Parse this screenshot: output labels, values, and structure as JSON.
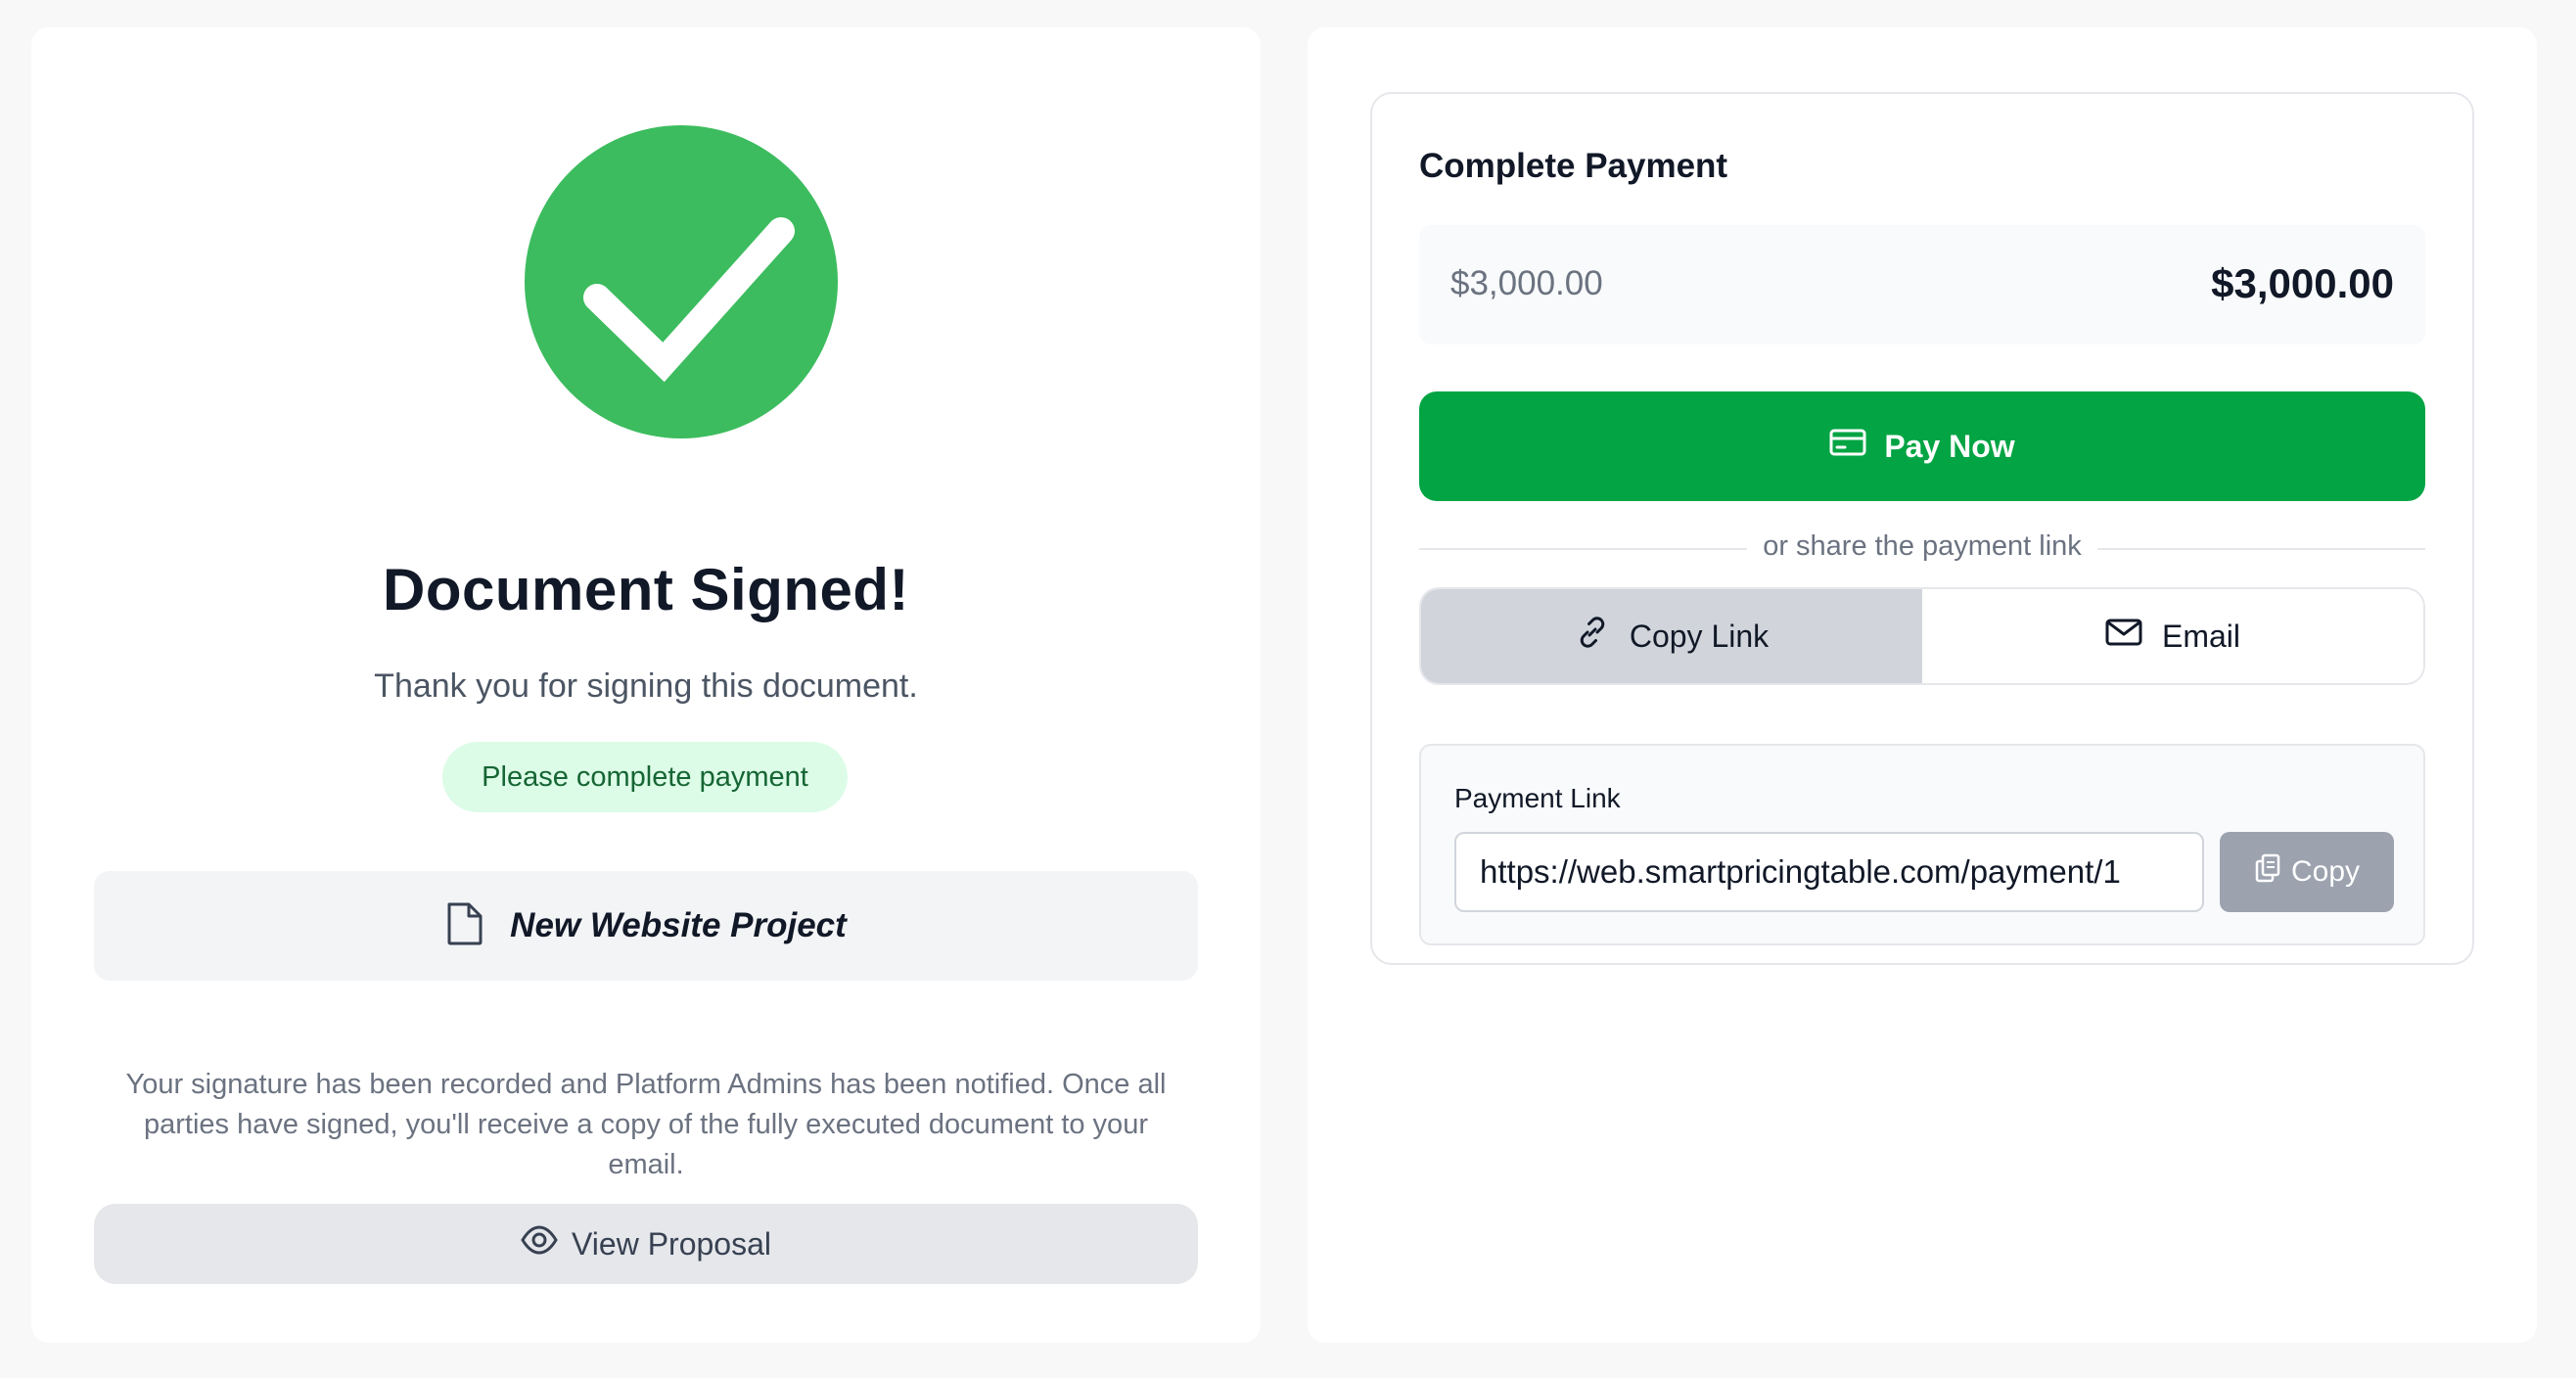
{
  "success": {
    "title": "Document Signed!",
    "subtitle": "Thank you for signing this document.",
    "status_badge": "Please complete payment",
    "document_name": "New Website Project",
    "notice": "Your signature has been recorded and Platform Admins has been notified. Once all parties have signed, you'll receive a copy of the fully executed document to your email.",
    "view_button_label": "View Proposal",
    "check_color": "#3cbc5e"
  },
  "payment": {
    "title": "Complete Payment",
    "amount_label": "$3,000.00",
    "amount_total": "$3,000.00",
    "pay_button_label": "Pay Now",
    "divider_text": "or share the payment link",
    "share_tabs": [
      {
        "label": "Copy Link",
        "icon": "link-icon",
        "active": true
      },
      {
        "label": "Email",
        "icon": "mail-icon",
        "active": false
      }
    ],
    "link_label": "Payment Link",
    "link_value": "https://web.smartpricingtable.com/payment/1",
    "copy_button_label": "Copy",
    "accent_color": "#02a443"
  }
}
